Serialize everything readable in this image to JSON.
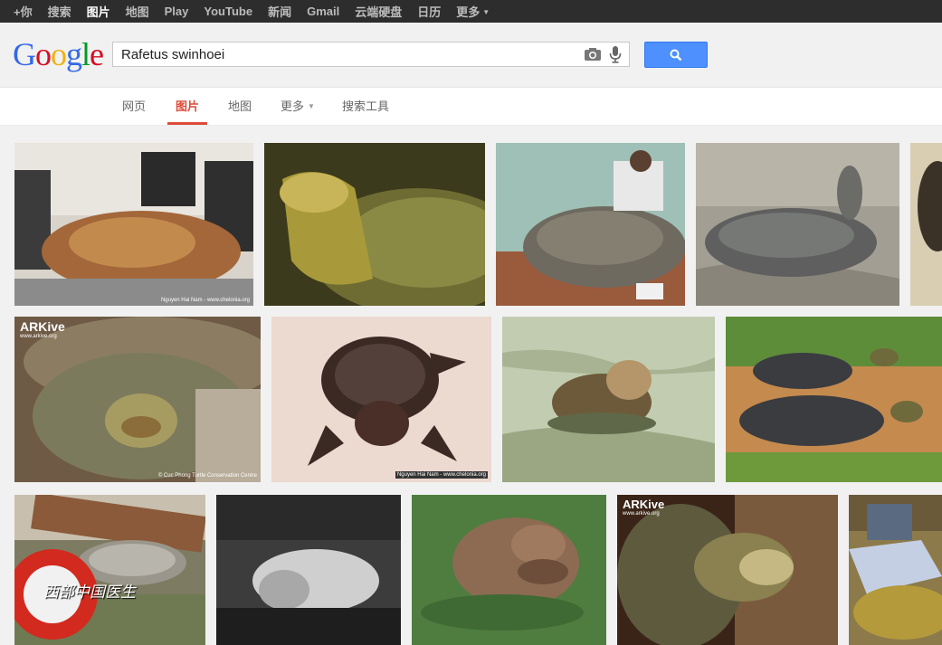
{
  "topbar": {
    "items": [
      "+你",
      "搜索",
      "图片",
      "地图",
      "Play",
      "YouTube",
      "新闻",
      "Gmail",
      "云端硬盘",
      "日历",
      "更多"
    ],
    "active_index": 2
  },
  "logo": {
    "text": "Google"
  },
  "search": {
    "query": "Rafetus swinhoei",
    "camera_icon": "camera-icon",
    "mic_icon": "microphone-icon",
    "button_icon": "search-icon"
  },
  "tabs": {
    "items": [
      "网页",
      "图片",
      "地图",
      "更多",
      "搜索工具"
    ],
    "active_index": 1,
    "accent_color": "#dd4b39"
  },
  "results": {
    "images": [
      {
        "label": "turtle-on-table-people",
        "watermark": "Nguyen Hai Nam - www.chelonia.org"
      },
      {
        "label": "turtle-closeup-yellow",
        "watermark": ""
      },
      {
        "label": "turtle-museum-man",
        "watermark": ""
      },
      {
        "label": "turtle-on-rocks",
        "watermark": ""
      },
      {
        "label": "turtle-edge-partial",
        "watermark": ""
      },
      {
        "label": "arkive-turtle-face",
        "watermark": "© Cuc Phong Turtle Conservation Centre",
        "brand": "ARKive",
        "brand_sub": "www.arkive.org"
      },
      {
        "label": "turtle-dark-specimen",
        "watermark": "Nguyen Hai Nam - www.chelonia.org"
      },
      {
        "label": "turtle-in-water-head-up",
        "watermark": ""
      },
      {
        "label": "two-turtles-on-grass",
        "watermark": ""
      },
      {
        "label": "turtle-logs-water",
        "watermark": "",
        "overlay_logo": "西部中国医生"
      },
      {
        "label": "turtle-grayscale-water",
        "watermark": ""
      },
      {
        "label": "turtle-head-in-water",
        "watermark": ""
      },
      {
        "label": "arkive-turtle-head",
        "watermark": "",
        "brand": "ARKive",
        "brand_sub": "www.arkive.org"
      },
      {
        "label": "turtle-held-by-people",
        "watermark": ""
      }
    ]
  },
  "colors": {
    "topbar_bg": "#2d2d2d",
    "search_button": "#4d90fe",
    "page_bg": "#f1f1f1"
  }
}
